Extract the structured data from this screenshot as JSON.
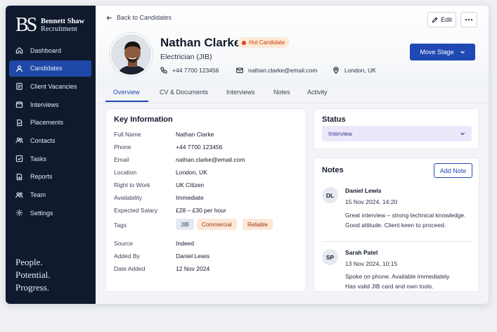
{
  "brand": {
    "mark": "BS",
    "line1": "Bennett Shaw",
    "line2": "Recruitment"
  },
  "nav": [
    {
      "label": "Dashboard",
      "icon": "dashboard-icon"
    },
    {
      "label": "Candidates",
      "icon": "users-icon",
      "active": true
    },
    {
      "label": "Client Vacancies",
      "icon": "clipboard-icon"
    },
    {
      "label": "Interviews",
      "icon": "calendar-icon"
    },
    {
      "label": "Placements",
      "icon": "briefcase-icon"
    },
    {
      "label": "Contacts",
      "icon": "contacts-icon"
    },
    {
      "label": "Tasks",
      "icon": "checkbox-icon"
    },
    {
      "label": "Reports",
      "icon": "chart-icon"
    },
    {
      "label": "Team",
      "icon": "team-icon"
    },
    {
      "label": "Settings",
      "icon": "gear-icon"
    }
  ],
  "tagline": [
    "People.",
    "Potential.",
    "Progress."
  ],
  "header": {
    "back_label": "Back to Candidates",
    "edit_label": "Edit",
    "move_stage_label": "Move Stage",
    "name": "Nathan Clarke",
    "badge": "Hot Candidate",
    "role": "Electrician (JIB)",
    "phone": "+44 7700 123456",
    "email": "nathan.clarke@email.com",
    "location": "London, UK"
  },
  "tabs": [
    "Overview",
    "CV & Documents",
    "Interviews",
    "Notes",
    "Activity"
  ],
  "key_info": {
    "title": "Key Information",
    "rows": [
      {
        "k": "Full Name",
        "v": "Nathan Clarke"
      },
      {
        "k": "Phone",
        "v": "+44 7700 123456"
      },
      {
        "k": "Email",
        "v": "nathan.clarke@email.com"
      },
      {
        "k": "Location",
        "v": "London, UK"
      },
      {
        "k": "Right to Work",
        "v": "UK Citizen"
      },
      {
        "k": "Availability",
        "v": "Immediate"
      },
      {
        "k": "Expected Salary",
        "v": "£28 – £30 per hour"
      }
    ],
    "tags_label": "Tags",
    "tags": [
      "JIB",
      "Commercial",
      "Reliable"
    ],
    "rows2": [
      {
        "k": "Source",
        "v": "Indeed"
      },
      {
        "k": "Added By",
        "v": "Daniel Lewis"
      },
      {
        "k": "Date Added",
        "v": "12 Nov 2024"
      }
    ]
  },
  "status": {
    "title": "Status",
    "value": "Interview"
  },
  "notes": {
    "title": "Notes",
    "add_label": "Add Note",
    "items": [
      {
        "initials": "DL",
        "author": "Daniel Lewis",
        "date": "15 Nov 2024, 14:20",
        "line1": "Great interview – strong technical knowledge.",
        "line2": "Good attitude. Client keen to proceed."
      },
      {
        "initials": "SP",
        "author": "Sarah Patel",
        "date": "13 Nov 2024, 10:15",
        "line1": "Spoke on phone. Available immediately.",
        "line2": "Has valid JIB card and own tools."
      }
    ]
  },
  "colors": {
    "sidebar": "#0f1a2e",
    "accent": "#1f49b3",
    "hot_badge_bg": "#fde9d7",
    "hot_badge_text": "#c2410c"
  }
}
